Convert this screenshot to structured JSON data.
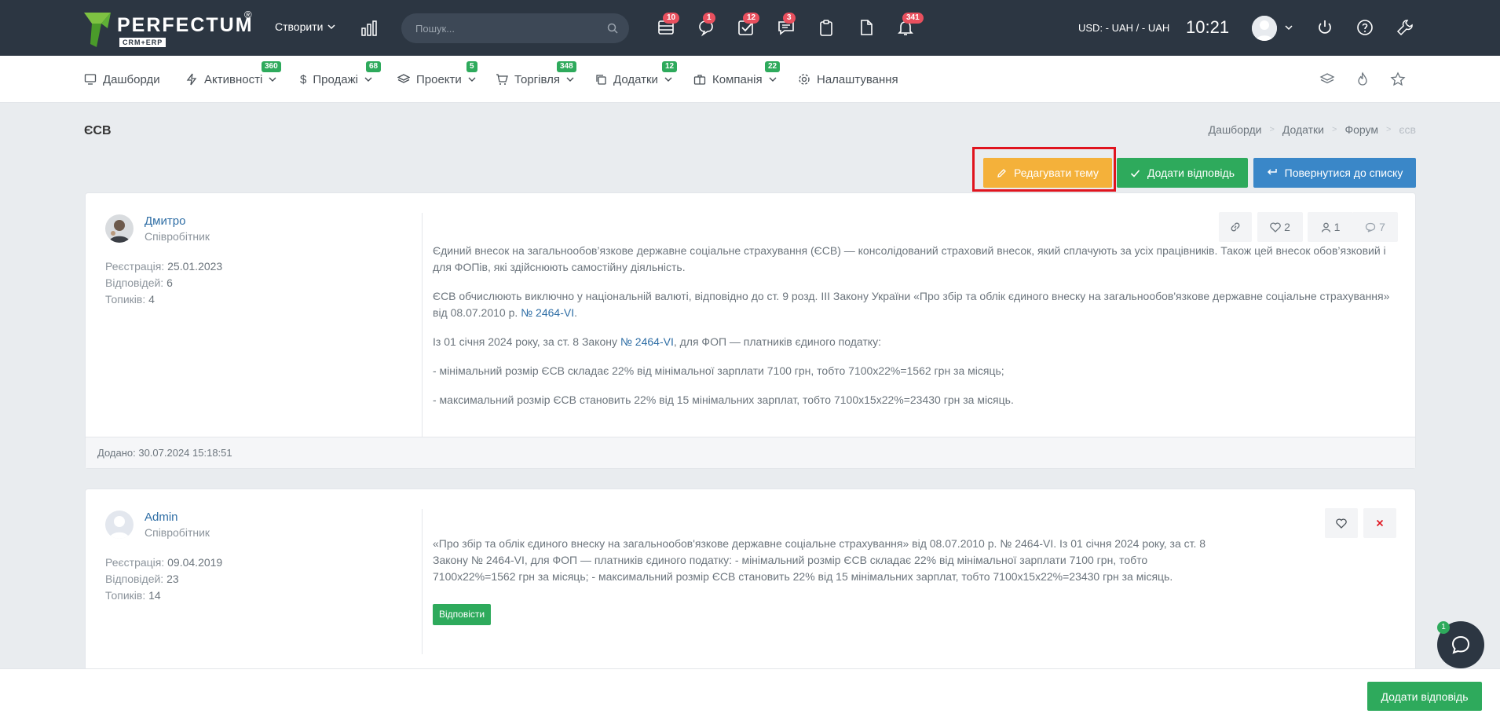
{
  "header": {
    "logo_text": "PERFECTUM",
    "logo_reg": "®",
    "logo_sub": "CRM+ERP",
    "create_label": "Створити",
    "search_placeholder": "Пошук...",
    "icons": [
      {
        "name": "calendar-grid-icon",
        "badge": "10"
      },
      {
        "name": "chat-icon",
        "badge": "1"
      },
      {
        "name": "tasks-check-icon",
        "badge": "12"
      },
      {
        "name": "messages-icon",
        "badge": "3"
      },
      {
        "name": "clipboard-icon",
        "badge": ""
      },
      {
        "name": "document-icon",
        "badge": ""
      },
      {
        "name": "bell-icon",
        "badge": "341"
      }
    ],
    "currency": "USD: - UAH / - UAH",
    "time": "10:21"
  },
  "menu": {
    "items": [
      {
        "label": "Дашборди",
        "badge": "",
        "icon": "monitor-icon"
      },
      {
        "label": "Активності",
        "badge": "360",
        "icon": "bolt-icon"
      },
      {
        "label": "Продажі",
        "badge": "68",
        "icon": "dollar-icon"
      },
      {
        "label": "Проекти",
        "badge": "5",
        "icon": "layers-icon"
      },
      {
        "label": "Торгівля",
        "badge": "348",
        "icon": "cart-icon"
      },
      {
        "label": "Додатки",
        "badge": "12",
        "icon": "copy-icon"
      },
      {
        "label": "Компанія",
        "badge": "22",
        "icon": "briefcase-icon"
      },
      {
        "label": "Налаштування",
        "badge": "",
        "icon": "gear-icon"
      }
    ]
  },
  "page": {
    "title": "ЄСВ",
    "breadcrumb": [
      "Дашборди",
      "Додатки",
      "Форум",
      "єсв"
    ],
    "buttons": {
      "edit": "Редагувати тему",
      "reply": "Додати відповідь",
      "back": "Повернутися до списку"
    }
  },
  "posts": [
    {
      "author": "Дмитро",
      "role": "Співробітник",
      "reg_label": "Реєстрація:",
      "reg_date": "25.01.2023",
      "answers_label": "Відповідей:",
      "answers": "6",
      "topics_label": "Топиків:",
      "topics": "4",
      "likes": "2",
      "users": "1",
      "comments": "7",
      "p1": "Єдиний внесок на загальнообов’язкове державне соціальне страхування (ЄСВ) — консолідований страховий внесок, який сплачують за усіх працівників. Також цей внесок обов’язковий і для ФОПів, які здійснюють самостійну діяльність.",
      "p2_text": "ЄСВ обчислюють виключно у національній валюті, відповідно до ст. 9 розд. III Закону України «Про збір та облік єдиного внеску на загальнообов'язкове державне соціальне страхування» від 08.07.2010 р.",
      "p2_link": "№ 2464-VI",
      "p2_end": ".",
      "p3_text": "Із 01 січня 2024 року, за ст. 8 Закону",
      "p3_link": "№ 2464-VI",
      "p3_end": ", для ФОП — платників єдиного податку:",
      "p4": "- мінімальний розмір ЄСВ складає 22% від мінімальної зарплати 7100 грн, тобто 7100х22%=1562 грн за місяць;",
      "p5": "- максимальний розмір ЄСВ становить 22% від 15 мінімальних зарплат, тобто 7100х15х22%=23430 грн за місяць.",
      "footer": "Додано: 30.07.2024 15:18:51"
    },
    {
      "author": "Admin",
      "role": "Співробітник",
      "reg_label": "Реєстрація:",
      "reg_date": "09.04.2019",
      "answers_label": "Відповідей:",
      "answers": "23",
      "topics_label": "Топиків:",
      "topics": "14",
      "body": "«Про збір та облік єдиного внеску на загальнообов'язкове державне соціальне страхування» від 08.07.2010 р. № 2464-VI. Із 01 січня 2024 року, за ст. 8 Закону № 2464-VI, для ФОП — платників єдиного податку: - мінімальний розмір ЄСВ складає 22% від мінімальної зарплати 7100 грн, тобто 7100х22%=1562 грн за місяць; - максимальний розмір ЄСВ становить 22% від 15 мінімальних зарплат, тобто 7100х15х22%=23430 грн за місяць.",
      "reply_label": "Відповісти"
    }
  ],
  "bottom": {
    "button": "Додати відповідь",
    "chat_badge": "1"
  }
}
